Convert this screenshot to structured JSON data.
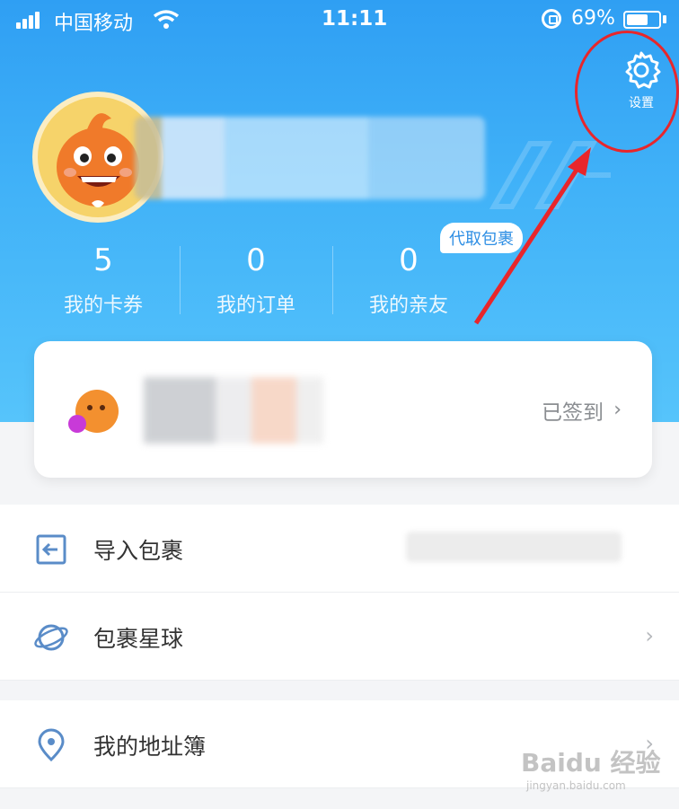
{
  "status_bar": {
    "carrier": "中国移动",
    "time": "11:11",
    "battery_percent": "69%",
    "battery_level": 0.69
  },
  "header": {
    "settings_label": "设置",
    "proxy_tag": "代取包裹",
    "accent_color": "#3aa9f6"
  },
  "stats": [
    {
      "value": "5",
      "label": "我的卡券"
    },
    {
      "value": "0",
      "label": "我的订单"
    },
    {
      "value": "0",
      "label": "我的亲友"
    }
  ],
  "signin_card": {
    "status": "已签到",
    "chevron": "›"
  },
  "menu": [
    {
      "label": "导入包裹",
      "icon": "import-icon"
    },
    {
      "label": "包裹星球",
      "icon": "planet-icon",
      "chevron": "›"
    },
    {
      "label": "我的地址簿",
      "icon": "location-pin-icon",
      "chevron": "›"
    }
  ],
  "watermark": {
    "main": "Baidu 经验",
    "sub": "jingyan.baidu.com"
  }
}
